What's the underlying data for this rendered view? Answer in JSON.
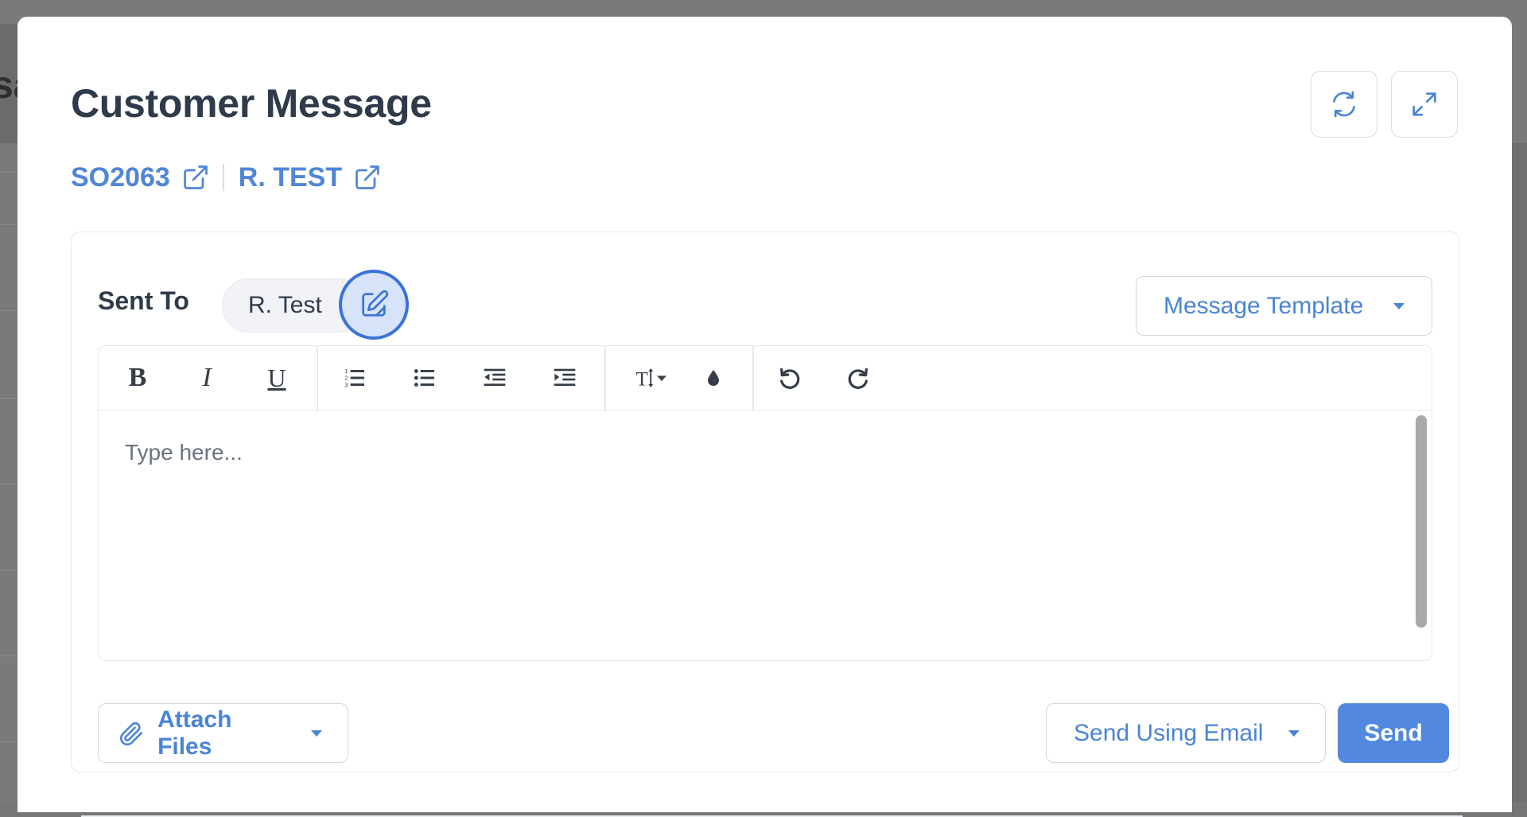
{
  "modal": {
    "title": "Customer Message",
    "refresh_icon": "refresh-icon",
    "expand_icon": "expand-icon"
  },
  "links": {
    "order": "SO2063",
    "customer": "R. TEST",
    "icon": "external-link-icon"
  },
  "recipients": {
    "label": "Sent To",
    "chip": "R. Test",
    "edit_icon": "edit-recipients-icon"
  },
  "template": {
    "label": "Message Template"
  },
  "toolbar": {
    "bold": "B",
    "italic": "I",
    "underline": "U",
    "items": [
      "bold",
      "italic",
      "underline",
      "ordered-list",
      "bullet-list",
      "outdent",
      "indent",
      "font-size",
      "text-color",
      "undo",
      "redo"
    ]
  },
  "editor": {
    "placeholder": "Type here..."
  },
  "footer": {
    "attach_label": "Attach Files",
    "send_using_label": "Send Using Email",
    "send_label": "Send"
  },
  "colors": {
    "accent": "#4a84d6",
    "send_button": "#5289de",
    "title": "#2f3a4a",
    "focus_ring": "#3a73d9"
  }
}
